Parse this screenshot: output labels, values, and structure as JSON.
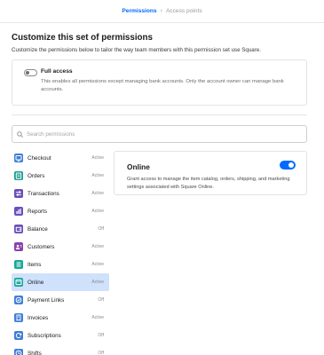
{
  "breadcrumb": {
    "current": "Permissions",
    "separator": "›",
    "next": "Access points"
  },
  "page": {
    "title": "Customize this set of permissions",
    "description": "Customize the permissions below to tailor the way team members with this permission set use Square."
  },
  "full_access": {
    "title": "Full access",
    "description": "This enables all permissions except managing bank accounts. Only the account owner can manage bank accounts.",
    "enabled": false
  },
  "search": {
    "placeholder": "Search permissions",
    "value": ""
  },
  "permissions": [
    {
      "name": "Checkout",
      "status": "Active",
      "icon": "checkout-icon",
      "color": "#3f7ed8"
    },
    {
      "name": "Orders",
      "status": "Active",
      "icon": "orders-icon",
      "color": "#1a9e8f"
    },
    {
      "name": "Transactions",
      "status": "Active",
      "icon": "transactions-icon",
      "color": "#6b4fbb"
    },
    {
      "name": "Reports",
      "status": "Active",
      "icon": "reports-icon",
      "color": "#6b4fbb"
    },
    {
      "name": "Balance",
      "status": "Off",
      "icon": "balance-icon",
      "color": "#6b4fbb"
    },
    {
      "name": "Customers",
      "status": "Active",
      "icon": "customers-icon",
      "color": "#8b3fb0"
    },
    {
      "name": "Items",
      "status": "Active",
      "icon": "items-icon",
      "color": "#1aa89a"
    },
    {
      "name": "Online",
      "status": "Active",
      "icon": "online-icon",
      "color": "#1aa89a",
      "selected": true
    },
    {
      "name": "Payment Links",
      "status": "Off",
      "icon": "payment-links-icon",
      "color": "#3f7ed8"
    },
    {
      "name": "Invoices",
      "status": "Active",
      "icon": "invoices-icon",
      "color": "#3f7ed8"
    },
    {
      "name": "Subscriptions",
      "status": "Off",
      "icon": "subscriptions-icon",
      "color": "#3f7ed8"
    },
    {
      "name": "Shifts",
      "status": "Off",
      "icon": "shifts-icon",
      "color": "#3f7ed8"
    }
  ],
  "detail": {
    "title": "Online",
    "description": "Grant access to manage the item catalog, orders, shipping, and marketing settings associated with Square Online.",
    "enabled": true
  },
  "colors": {
    "accent": "#006aff",
    "selected_row": "#cfe1fb"
  }
}
